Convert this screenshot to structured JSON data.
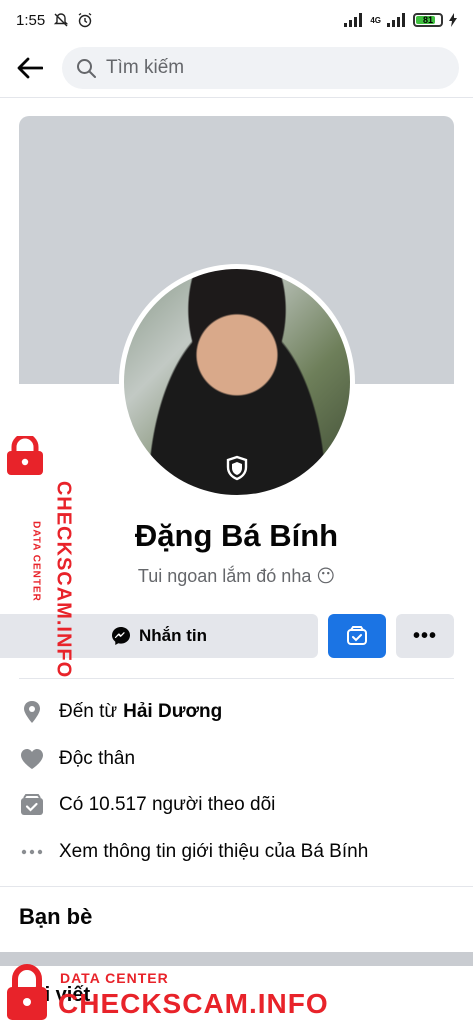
{
  "status_bar": {
    "time": "1:55",
    "network": "4G",
    "battery": "81",
    "battery_level": 0.81
  },
  "top_bar": {
    "back_icon": "back-arrow-icon",
    "search_placeholder": "Tìm kiếm"
  },
  "profile": {
    "name": "Đặng Bá Bính",
    "bio": "Tui ngoan lắm đó nha 😶"
  },
  "actions": {
    "message_label": "Nhắn tin",
    "more_label": "•••"
  },
  "info": {
    "from_prefix": "Đến từ",
    "from_place": "Hải Dương",
    "relationship": "Độc thân",
    "followers": "Có 10.517 người theo dõi",
    "see_more": "Xem thông tin giới thiệu của Bá Bính"
  },
  "sections": {
    "friends": "Bạn bè",
    "posts": "Bài viết"
  },
  "watermark": {
    "sub": "DATA CENTER",
    "main": "CHECKSCAM.INFO"
  },
  "colors": {
    "accent": "#1b74e4",
    "watermark": "#e8232a",
    "cover": "#ccd0d5"
  }
}
